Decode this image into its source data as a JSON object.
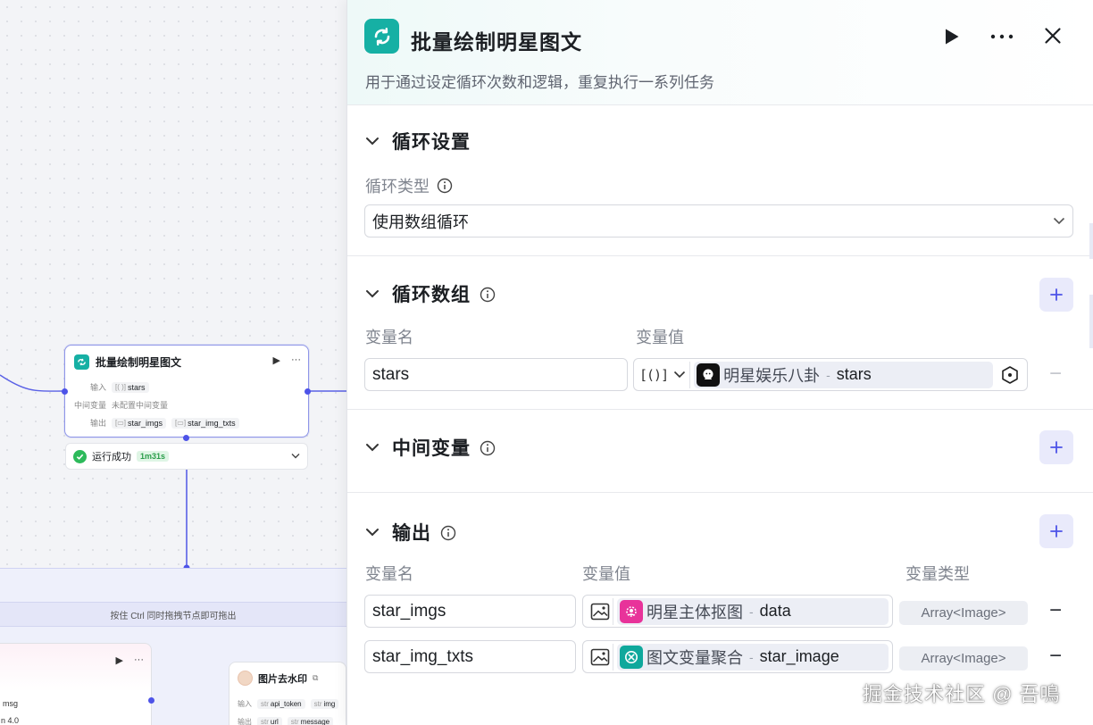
{
  "canvas": {
    "loop_node": {
      "title": "批量绘制明星图文",
      "input_label": "输入",
      "input_var": "stars",
      "mid_label": "中间变量",
      "mid_value": "未配置中间变量",
      "output_label": "输出",
      "outputs": [
        "star_imgs",
        "star_img_txts"
      ]
    },
    "run_status": {
      "label": "运行成功",
      "time": "1m31s"
    },
    "drag_hint": "按住 Ctrl 同时拖拽节点即可拖出",
    "left_frag": {
      "msg": "msg",
      "version": "n 4.0"
    },
    "wm_node": {
      "title": "图片去水印",
      "input_label": "输入",
      "inputs": [
        "api_token",
        "img"
      ],
      "output_label": "输出",
      "outputs": [
        "url",
        "message"
      ],
      "type_tag": "str"
    }
  },
  "panel": {
    "title": "批量绘制明星图文",
    "description": "用于通过设定循环次数和逻辑，重复执行一系列任务",
    "loop_settings": {
      "title": "循环设置",
      "type_label": "循环类型",
      "type_value": "使用数组循环"
    },
    "loop_array": {
      "title": "循环数组",
      "col_name": "变量名",
      "col_value": "变量值",
      "row": {
        "name": "stars",
        "source": "明星娱乐八卦",
        "var": "stars"
      }
    },
    "mid_vars": {
      "title": "中间变量"
    },
    "output": {
      "title": "输出",
      "col_name": "变量名",
      "col_value": "变量值",
      "col_type": "变量类型",
      "rows": [
        {
          "name": "star_imgs",
          "source": "明星主体抠图",
          "var": "data",
          "type": "Array<Image>"
        },
        {
          "name": "star_img_txts",
          "source": "图文变量聚合",
          "var": "star_image",
          "type": "Array<Image>"
        }
      ]
    }
  },
  "watermark": "掘金技术社区 @ 吾鳴",
  "colors": {
    "accent": "#4d53e8",
    "loop_icon": "#16b0a4",
    "success": "#2dba5b",
    "cutout_icon": "#e8339a",
    "aggregate_icon": "#0fa89c"
  }
}
